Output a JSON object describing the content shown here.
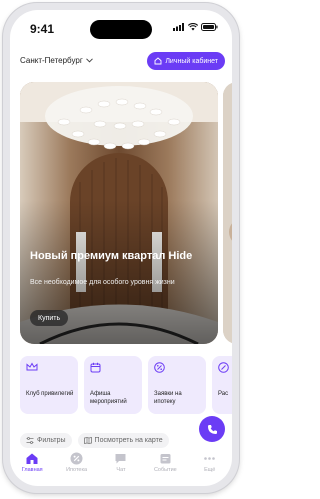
{
  "status": {
    "time": "9:41"
  },
  "header": {
    "city": "Санкт-Петербург",
    "cabinet_label": "Личный кабинет"
  },
  "hero": {
    "title": "Новый премиум квартал Hide",
    "subtitle": "Все необходимое для особого уровня жизни",
    "button_label": "Купить"
  },
  "tiles": [
    {
      "label": "Клуб привилегий",
      "icon": "crown-icon"
    },
    {
      "label": "Афиша мероприятий",
      "icon": "calendar-icon"
    },
    {
      "label": "Заявки на ипотеку",
      "icon": "percent-icon"
    },
    {
      "label": "Рас",
      "icon": "percent-icon"
    }
  ],
  "filters": {
    "filters_label": "Фильтры",
    "map_label": "Посмотреть на карте"
  },
  "tabbar": [
    {
      "label": "Главная",
      "icon": "home-icon",
      "active": true
    },
    {
      "label": "Ипотека",
      "icon": "percent-icon",
      "active": false
    },
    {
      "label": "Чат",
      "icon": "chat-icon",
      "active": false
    },
    {
      "label": "Событие",
      "icon": "event-icon",
      "active": false
    },
    {
      "label": "Ещё",
      "icon": "more-icon",
      "active": false
    }
  ],
  "colors": {
    "accent": "#6b3cf5",
    "tile_bg": "#efeafd"
  }
}
